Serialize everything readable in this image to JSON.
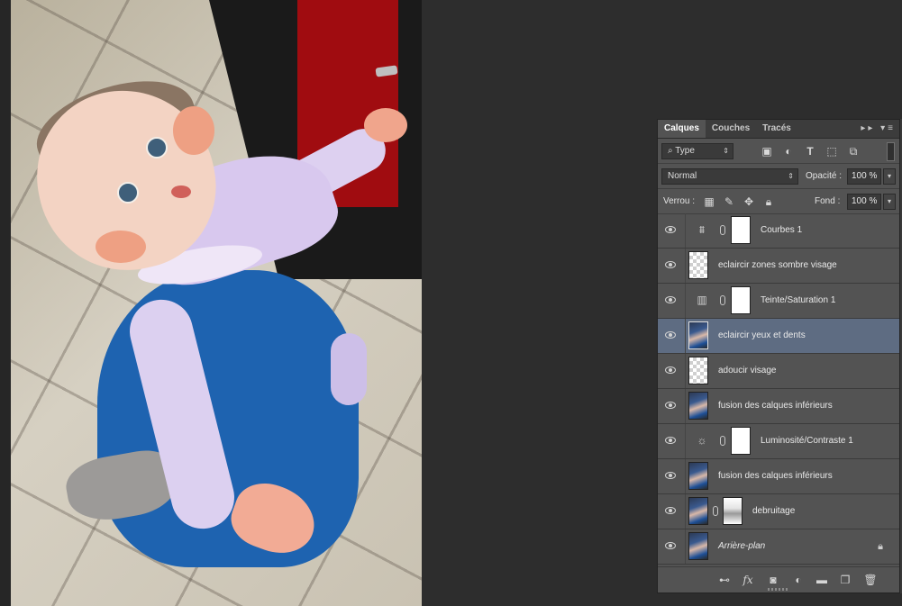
{
  "panel": {
    "tabs": [
      "Calques",
      "Couches",
      "Tracés"
    ],
    "tab_controls": "▸▸ ▾≡"
  },
  "filter": {
    "kind_label": "Type",
    "kind_arrow": "⇕",
    "icons": [
      "image-filter-icon",
      "adjustment-filter-icon",
      "text-filter-icon",
      "shape-filter-icon",
      "smart-object-filter-icon"
    ]
  },
  "blend": {
    "mode": "Normal",
    "opacity_label": "Opacité :",
    "opacity_value": "100 %"
  },
  "lock": {
    "label": "Verrou :",
    "fill_label": "Fond :",
    "fill_value": "100 %"
  },
  "layers": [
    {
      "name": "Courbes 1",
      "type": "adjustment",
      "adjustment_icon": "curves-icon",
      "has_mask": true,
      "selected": false
    },
    {
      "name": "eclaircir zones sombre visage",
      "type": "transparent",
      "selected": false
    },
    {
      "name": "Teinte/Saturation 1",
      "type": "adjustment",
      "adjustment_icon": "hue-saturation-icon",
      "has_mask": true,
      "selected": false
    },
    {
      "name": "eclaircir yeux et dents",
      "type": "photo",
      "selected": true
    },
    {
      "name": "adoucir visage",
      "type": "transparent",
      "selected": false
    },
    {
      "name": "fusion des calques inférieurs",
      "type": "photo",
      "selected": false
    },
    {
      "name": "Luminosité/Contraste 1",
      "type": "adjustment",
      "adjustment_icon": "brightness-contrast-icon",
      "has_mask": true,
      "selected": false
    },
    {
      "name": "fusion des calques inférieurs",
      "type": "photo",
      "selected": false
    },
    {
      "name": "debruitage",
      "type": "photo",
      "has_mask": true,
      "selected": false
    },
    {
      "name": "Arrière-plan",
      "type": "photo",
      "italic": true,
      "locked": true,
      "selected": false
    }
  ],
  "bottom_icons": [
    "link-layers-icon",
    "fx-icon",
    "add-mask-icon",
    "new-adjustment-icon",
    "new-group-icon",
    "new-layer-icon",
    "trash-icon"
  ],
  "colors": {
    "panel_bg": "#535353",
    "selected_layer": "#5e6c82",
    "app_bg": "#2d2d2d"
  }
}
